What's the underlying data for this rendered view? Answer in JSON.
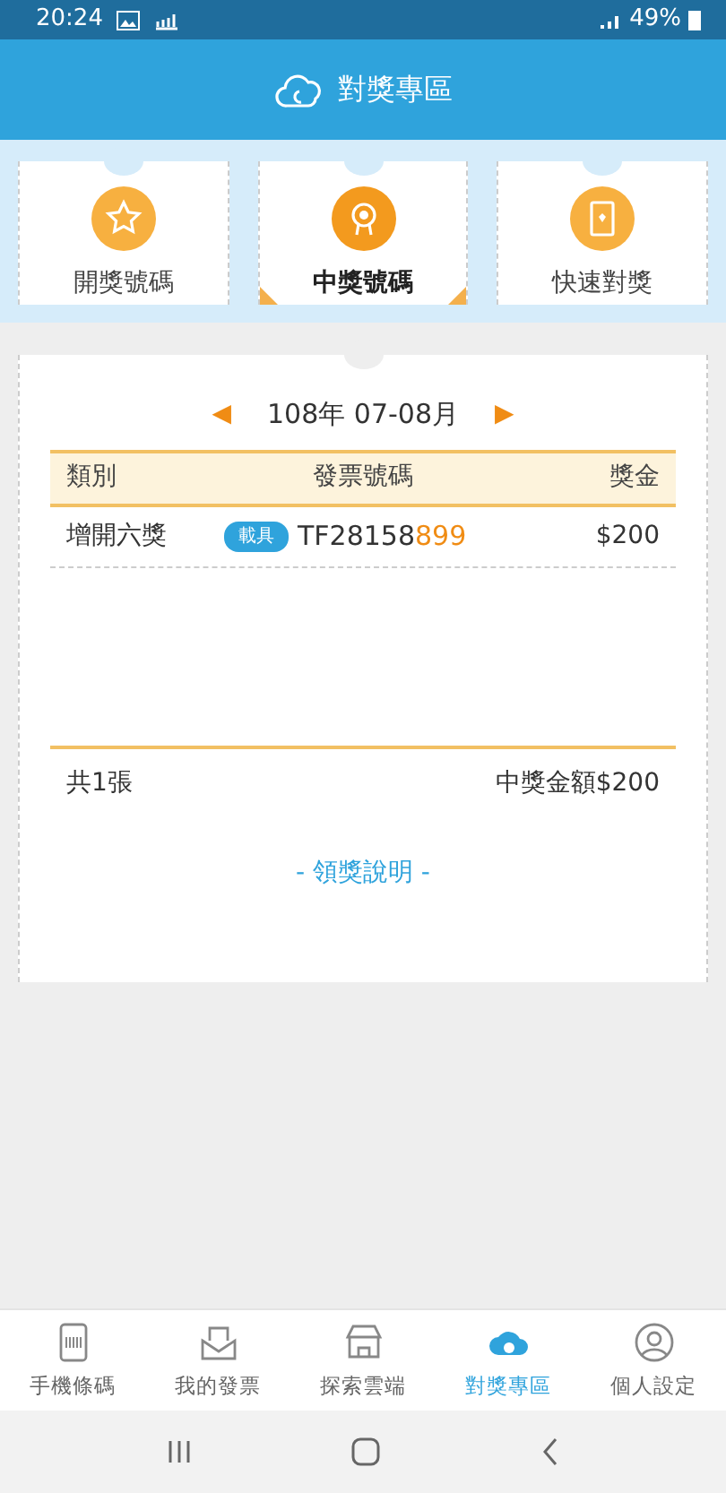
{
  "status_bar": {
    "time": "20:24",
    "battery": "49%"
  },
  "header": {
    "title": "對獎專區"
  },
  "tabs": [
    {
      "label": "開獎號碼",
      "selected": false
    },
    {
      "label": "中獎號碼",
      "selected": true
    },
    {
      "label": "快速對獎",
      "selected": false
    }
  ],
  "period": {
    "prev": "◀",
    "label": "108年 07-08月",
    "next": "▶"
  },
  "table": {
    "columns": [
      "類別",
      "發票號碼",
      "獎金"
    ],
    "rows": [
      {
        "category": "增開六獎",
        "tag": "載具",
        "number": "TF28158",
        "number_match": "899",
        "amount": "$200"
      }
    ]
  },
  "summary": {
    "count": "共1張",
    "total": "中獎金額$200"
  },
  "help_link": "- 領獎說明 -",
  "bottom_nav": [
    {
      "label": "手機條碼",
      "selected": false
    },
    {
      "label": "我的發票",
      "selected": false
    },
    {
      "label": "探索雲端",
      "selected": false
    },
    {
      "label": "對獎專區",
      "selected": true
    },
    {
      "label": "個人設定",
      "selected": false
    }
  ]
}
